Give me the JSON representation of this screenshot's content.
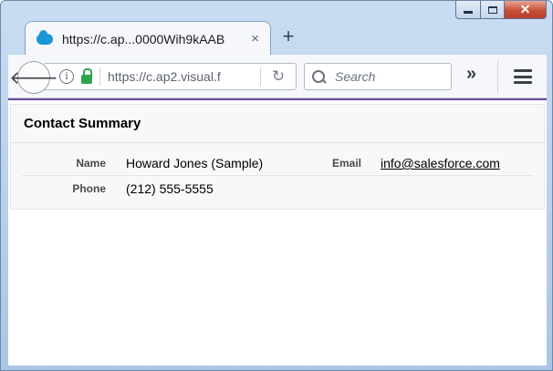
{
  "browser": {
    "tab_title": "https://c.ap...0000Wih9kAAB",
    "tab_close": "×",
    "new_tab": "+",
    "url": "https://c.ap2.visual.f",
    "search_placeholder": "Search",
    "overflow": "»"
  },
  "icons": {
    "back": "arrow-left-icon",
    "reload": "reload-icon",
    "menu": "hamburger-menu-icon",
    "info": "info-icon",
    "lock": "lock-icon",
    "search": "search-icon"
  },
  "colors": {
    "accent_border": "#6a4b9c",
    "lock_green": "#2ea44f",
    "favicon_blue": "#1b96d6",
    "close_red": "#c7503a"
  },
  "page": {
    "section_title": "Contact Summary",
    "fields": {
      "name_label": "Name",
      "name_value": "Howard Jones (Sample)",
      "email_label": "Email",
      "email_value": "info@salesforce.com",
      "phone_label": "Phone",
      "phone_value": "(212) 555-5555"
    }
  }
}
